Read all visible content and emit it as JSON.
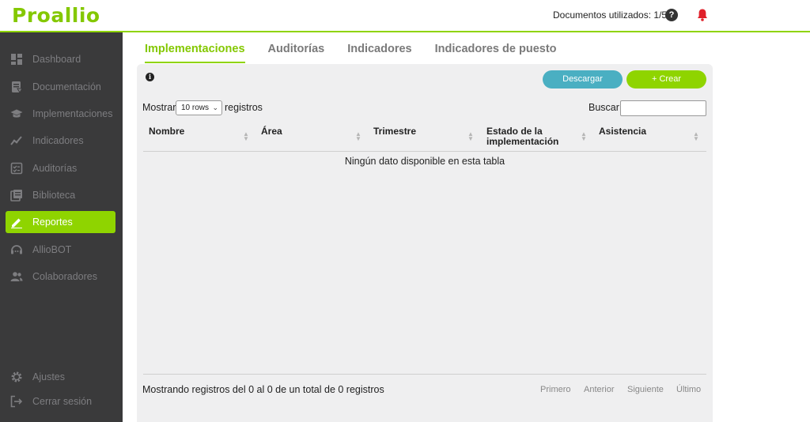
{
  "app": {
    "logo": "Proallio",
    "docs_used": "Documentos utilizados: 1/50",
    "colors": {
      "accent": "#8fd400",
      "sidebar": "#3a3a3b",
      "download": "#4aafc2",
      "bell": "#e0202a"
    }
  },
  "sidebar": {
    "items": [
      {
        "label": "Dashboard",
        "icon": "dashboard-icon"
      },
      {
        "label": "Documentación",
        "icon": "document-icon"
      },
      {
        "label": "Implementaciones",
        "icon": "graduation-cap-icon"
      },
      {
        "label": "Indicadores",
        "icon": "trend-line-icon"
      },
      {
        "label": "Auditorías",
        "icon": "checklist-icon"
      },
      {
        "label": "Biblioteca",
        "icon": "library-icon"
      },
      {
        "label": "Reportes",
        "icon": "pencil-icon",
        "active": true
      },
      {
        "label": "AllioBOT",
        "icon": "bot-icon"
      },
      {
        "label": "Colaboradores",
        "icon": "users-icon"
      }
    ],
    "bottom": [
      {
        "label": "Ajustes",
        "icon": "gear-icon"
      },
      {
        "label": "Cerrar sesión",
        "icon": "logout-icon"
      }
    ]
  },
  "tabs": [
    {
      "label": "Implementaciones",
      "active": true
    },
    {
      "label": "Auditorías"
    },
    {
      "label": "Indicadores"
    },
    {
      "label": "Indicadores de puesto"
    }
  ],
  "panel": {
    "download_label": "Descargar",
    "create_label": "+ Crear",
    "show_label": "Mostrar",
    "rows_value": "10 rows",
    "records_label": "registros",
    "search_label": "Buscar:",
    "search_value": "",
    "columns": [
      "Nombre",
      "Área",
      "Trimestre",
      "Estado de la implementación",
      "Asistencia"
    ],
    "column_lines": [
      [
        "Nombre"
      ],
      [
        "Área"
      ],
      [
        "Trimestre"
      ],
      [
        "Estado de la",
        "implementación"
      ],
      [
        "Asistencia"
      ]
    ],
    "empty_message": "Ningún dato disponible en esta tabla",
    "info_text": "Mostrando registros del 0 al 0 de un total de 0 registros",
    "pager": {
      "first": "Primero",
      "prev": "Anterior",
      "next": "Siguiente",
      "last": "Último"
    }
  }
}
